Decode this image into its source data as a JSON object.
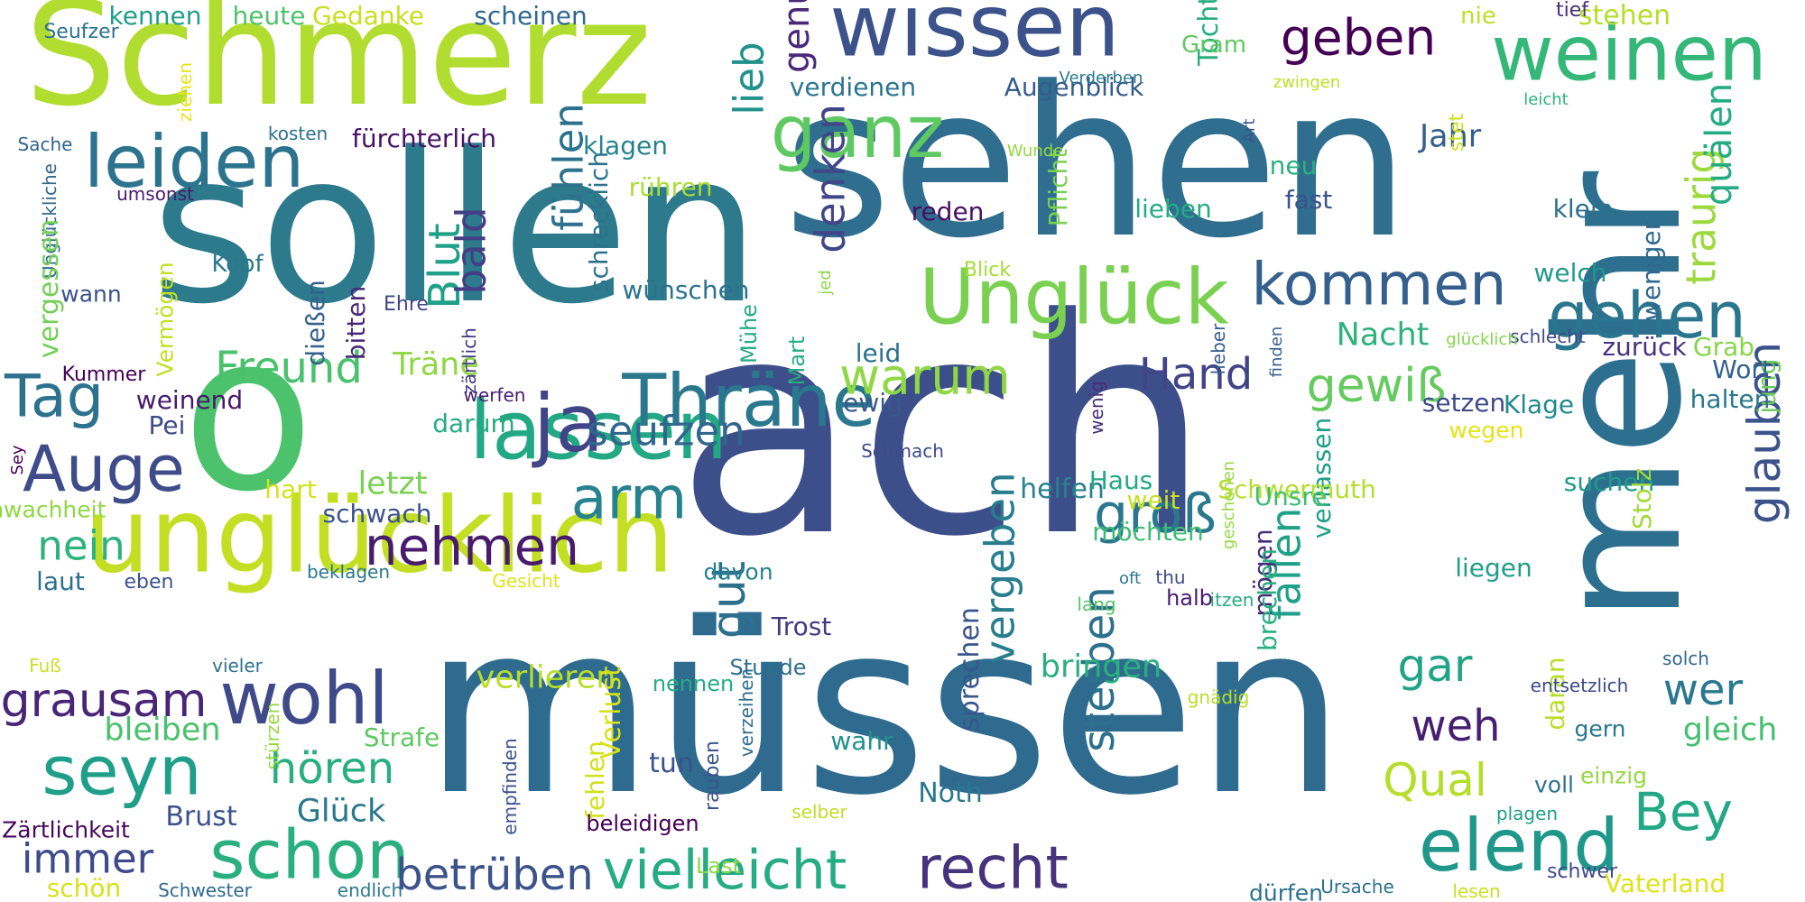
{
  "words": [
    {
      "text": "ach",
      "color": "#3d4f8a"
    },
    {
      "text": "müssen",
      "color": "#2e6b8e"
    },
    {
      "text": "sehen",
      "color": "#2f6e8e"
    },
    {
      "text": "sollen",
      "color": "#2c7a8c"
    },
    {
      "text": "mehr",
      "color": "#2d6f8e"
    },
    {
      "text": "Schmerz",
      "color": "#b0dd2f"
    },
    {
      "text": "o",
      "color": "#4cc26c"
    },
    {
      "text": "unglücklich",
      "color": "#c2df23"
    },
    {
      "text": "wissen",
      "color": "#3b528b"
    },
    {
      "text": "Unglück",
      "color": "#7ad151"
    },
    {
      "text": "weinen",
      "color": "#35b779"
    },
    {
      "text": "lassen",
      "color": "#22a884"
    },
    {
      "text": "Thräne",
      "color": "#2a788e"
    },
    {
      "text": "ganz",
      "color": "#5ec962"
    },
    {
      "text": "leiden",
      "color": "#2c738e"
    },
    {
      "text": "ja",
      "color": "#414487"
    },
    {
      "text": "kommen",
      "color": "#355f8d"
    },
    {
      "text": "gehen",
      "color": "#2a768e"
    },
    {
      "text": "elend",
      "color": "#1f988b"
    },
    {
      "text": "seyn",
      "color": "#1f9e89"
    },
    {
      "text": "schon",
      "color": "#2ab07f"
    },
    {
      "text": "wohl",
      "color": "#3e4a89"
    },
    {
      "text": "recht",
      "color": "#46337e"
    },
    {
      "text": "vielleicht",
      "color": "#25ac82"
    },
    {
      "text": "Auge",
      "color": "#3e4c8a"
    },
    {
      "text": "Tag",
      "color": "#2c728e"
    },
    {
      "text": "geben",
      "color": "#440154"
    },
    {
      "text": "warum",
      "color": "#8fd744"
    },
    {
      "text": "nehmen",
      "color": "#481b6d"
    },
    {
      "text": "arm",
      "color": "#26828e"
    },
    {
      "text": "groß",
      "color": "#2a788e"
    },
    {
      "text": "Bey",
      "color": "#22a884"
    },
    {
      "text": "traurig",
      "color": "#9bd93c"
    },
    {
      "text": "glauben",
      "color": "#3b528b"
    },
    {
      "text": "grausam",
      "color": "#482576"
    },
    {
      "text": "gewiß",
      "color": "#65cb5e"
    },
    {
      "text": "fallen",
      "color": "#1fa088"
    },
    {
      "text": "vergeben",
      "color": "#287d8e"
    },
    {
      "text": "sterben",
      "color": "#2d708e"
    },
    {
      "text": "betrüben",
      "color": "#3b528b"
    },
    {
      "text": "gar",
      "color": "#20a386"
    },
    {
      "text": "wer",
      "color": "#2a788e"
    },
    {
      "text": "Hand",
      "color": "#414487"
    },
    {
      "text": "gut",
      "color": "#2d708e"
    },
    {
      "text": "Freund",
      "color": "#4ac16d"
    },
    {
      "text": "seufzen",
      "color": "#31668e"
    },
    {
      "text": "Blut",
      "color": "#1fa088"
    },
    {
      "text": "bald",
      "color": "#433e85"
    },
    {
      "text": "fühlen",
      "color": "#2c728e"
    },
    {
      "text": "denken",
      "color": "#404688"
    },
    {
      "text": "lieb",
      "color": "#21918c"
    },
    {
      "text": "genug",
      "color": "#482878"
    },
    {
      "text": "Qual",
      "color": "#b5de2b"
    },
    {
      "text": "weh",
      "color": "#481f70"
    },
    {
      "text": "quälen",
      "color": "#25ac82"
    },
    {
      "text": "hören",
      "color": "#29af7f"
    },
    {
      "text": "nein",
      "color": "#2db27d"
    },
    {
      "text": "immer",
      "color": "#3e4a89"
    },
    {
      "text": "bringen",
      "color": "#2ab07f"
    },
    {
      "text": "verlieren",
      "color": "#b8de29"
    },
    {
      "text": "gleich",
      "color": "#44bf70"
    },
    {
      "text": "Glück",
      "color": "#2a788e"
    },
    {
      "text": "Jahr",
      "color": "#355f8d"
    },
    {
      "text": "Nacht",
      "color": "#2db27d"
    },
    {
      "text": "letzt",
      "color": "#7ad151"
    },
    {
      "text": "Träne",
      "color": "#8fd744"
    },
    {
      "text": "bleiben",
      "color": "#4ac16d"
    },
    {
      "text": "Pflicht",
      "color": "#7ad151"
    },
    {
      "text": "ewig",
      "color": "#38598c"
    },
    {
      "text": "leid",
      "color": "#2c728e"
    },
    {
      "text": "helfen",
      "color": "#26828e"
    },
    {
      "text": "sprechen",
      "color": "#39568c"
    },
    {
      "text": "schrecklich",
      "color": "#2c728e"
    },
    {
      "text": "Brust",
      "color": "#3b528b"
    },
    {
      "text": "Noth",
      "color": "#2a788e"
    },
    {
      "text": "tun",
      "color": "#3b528b"
    },
    {
      "text": "fehlen",
      "color": "#d0e11c"
    },
    {
      "text": "Verlust",
      "color": "#d8e219"
    },
    {
      "text": "wahr",
      "color": "#21918c"
    },
    {
      "text": "Haus",
      "color": "#22a884"
    },
    {
      "text": "setzen",
      "color": "#3e4a89"
    },
    {
      "text": "Klage",
      "color": "#23898e"
    },
    {
      "text": "suchen",
      "color": "#1f9a8a"
    },
    {
      "text": "Stolz",
      "color": "#a2da37"
    },
    {
      "text": "jung",
      "color": "#6ccd5a"
    },
    {
      "text": "halten",
      "color": "#2a788e"
    },
    {
      "text": "Wort",
      "color": "#33638d"
    },
    {
      "text": "Grab",
      "color": "#86d549"
    },
    {
      "text": "zurück",
      "color": "#46327e"
    },
    {
      "text": "weniger",
      "color": "#31688e"
    },
    {
      "text": "welch",
      "color": "#1f9a8a"
    },
    {
      "text": "klein",
      "color": "#2d708e"
    },
    {
      "text": "fast",
      "color": "#3b528b"
    },
    {
      "text": "neu",
      "color": "#2ab07f"
    },
    {
      "text": "lieben",
      "color": "#25ac82"
    },
    {
      "text": "reden",
      "color": "#471063"
    },
    {
      "text": "verlassen",
      "color": "#1f9e89"
    },
    {
      "text": "Tochter",
      "color": "#29af7f"
    },
    {
      "text": "Gram",
      "color": "#5ec962"
    },
    {
      "text": "Augenblick",
      "color": "#365c8d"
    },
    {
      "text": "verdienen",
      "color": "#2a768e"
    },
    {
      "text": "klagen",
      "color": "#25838e"
    },
    {
      "text": "rühren",
      "color": "#aadc32"
    },
    {
      "text": "fürchterlich",
      "color": "#471365"
    },
    {
      "text": "scheinen",
      "color": "#30698e"
    },
    {
      "text": "kennen",
      "color": "#1f9e89"
    },
    {
      "text": "heute",
      "color": "#4ec36b"
    },
    {
      "text": "Gedanke",
      "color": "#c8e020"
    },
    {
      "text": "stehen",
      "color": "#b5de2b"
    },
    {
      "text": "nie",
      "color": "#bddf26"
    },
    {
      "text": "tief",
      "color": "#472d7b"
    },
    {
      "text": "Seufzer",
      "color": "#2c728e"
    },
    {
      "text": "ziehen",
      "color": "#e5e419"
    },
    {
      "text": "Sache",
      "color": "#33638d"
    },
    {
      "text": "kosten",
      "color": "#2c728e"
    },
    {
      "text": "umsonst",
      "color": "#481b6d"
    },
    {
      "text": "Unglückliche",
      "color": "#31688e"
    },
    {
      "text": "vergessen",
      "color": "#73d056"
    },
    {
      "text": "Kopf",
      "color": "#2a788e"
    },
    {
      "text": "Vermögen",
      "color": "#c2df23"
    },
    {
      "text": "wann",
      "color": "#3b528b"
    },
    {
      "text": "Kummer",
      "color": "#440154"
    },
    {
      "text": "weinend",
      "color": "#481a6c"
    },
    {
      "text": "Pei",
      "color": "#3e4a89"
    },
    {
      "text": "Sey",
      "color": "#440154"
    },
    {
      "text": "Schwachheit",
      "color": "#8fd744"
    },
    {
      "text": "hart",
      "color": "#d2e21b"
    },
    {
      "text": "laut",
      "color": "#2d708e"
    },
    {
      "text": "eben",
      "color": "#3b528b"
    },
    {
      "text": "Fuß",
      "color": "#c8e020"
    },
    {
      "text": "vieler",
      "color": "#2c728e"
    },
    {
      "text": "Zärtlichkeit",
      "color": "#46085c"
    },
    {
      "text": "schön",
      "color": "#d8e219"
    },
    {
      "text": "Schwester",
      "color": "#30698e"
    },
    {
      "text": "endlich",
      "color": "#2a788e"
    },
    {
      "text": "stürzen",
      "color": "#95d840"
    },
    {
      "text": "Strafe",
      "color": "#5ec962"
    },
    {
      "text": "dießen",
      "color": "#355f8d"
    },
    {
      "text": "bitten",
      "color": "#482878"
    },
    {
      "text": "Ehre",
      "color": "#404588"
    },
    {
      "text": "zärtlich",
      "color": "#443983"
    },
    {
      "text": "darum",
      "color": "#25ac82"
    },
    {
      "text": "werfen",
      "color": "#481c6e"
    },
    {
      "text": "schwach",
      "color": "#3b528b"
    },
    {
      "text": "beklagen",
      "color": "#2a788e"
    },
    {
      "text": "Gesicht",
      "color": "#dfe318"
    },
    {
      "text": "davon",
      "color": "#26828e"
    },
    {
      "text": "Trost",
      "color": "#443a83"
    },
    {
      "text": "Stunde",
      "color": "#2d708e"
    },
    {
      "text": "nennen",
      "color": "#25ac82"
    },
    {
      "text": "verzeihen",
      "color": "#2f6c8e"
    },
    {
      "text": "rauben",
      "color": "#3a548c"
    },
    {
      "text": "beleidigen",
      "color": "#440154"
    },
    {
      "text": "empfinden",
      "color": "#3b528b"
    },
    {
      "text": "selber",
      "color": "#c0df25"
    },
    {
      "text": "Last",
      "color": "#8fd744"
    },
    {
      "text": "Mühe",
      "color": "#25ac82"
    },
    {
      "text": "Mart",
      "color": "#27ad81"
    },
    {
      "text": "wünschen",
      "color": "#2c728e"
    },
    {
      "text": "jed",
      "color": "#89d548"
    },
    {
      "text": "Blick",
      "color": "#a5db36"
    },
    {
      "text": "Wunde",
      "color": "#95d840"
    },
    {
      "text": "Verderben",
      "color": "#2a788e"
    },
    {
      "text": "Art",
      "color": "#3b528b"
    },
    {
      "text": "zwingen",
      "color": "#bddf26"
    },
    {
      "text": "leicht",
      "color": "#2db27d"
    },
    {
      "text": "stet",
      "color": "#cae11f"
    },
    {
      "text": "schlecht",
      "color": "#3e4989"
    },
    {
      "text": "glücklich",
      "color": "#84d44b"
    },
    {
      "text": "lieber",
      "color": "#355f8d"
    },
    {
      "text": "wenig",
      "color": "#472c7a"
    },
    {
      "text": "finden",
      "color": "#355f8d"
    },
    {
      "text": "geschehen",
      "color": "#95d840"
    },
    {
      "text": "Schwermuth",
      "color": "#b5de2b"
    },
    {
      "text": "wegen",
      "color": "#e5e419"
    },
    {
      "text": "Unsre",
      "color": "#3fbc73"
    },
    {
      "text": "weit",
      "color": "#cae11f"
    },
    {
      "text": "möchten",
      "color": "#3fbc73"
    },
    {
      "text": "thu",
      "color": "#3e4a89"
    },
    {
      "text": "oft",
      "color": "#2a788e"
    },
    {
      "text": "lang",
      "color": "#56c667"
    },
    {
      "text": "halb",
      "color": "#481b6d"
    },
    {
      "text": "itzen",
      "color": "#27ad81"
    },
    {
      "text": "mögen",
      "color": "#472d7b"
    },
    {
      "text": "brechen",
      "color": "#2ab07f"
    },
    {
      "text": "liegen",
      "color": "#1f9e89"
    },
    {
      "text": "solch",
      "color": "#31688e"
    },
    {
      "text": "daran",
      "color": "#b8de29"
    },
    {
      "text": "entsetzlich",
      "color": "#3e4a89"
    },
    {
      "text": "gern",
      "color": "#2a788e"
    },
    {
      "text": "gnädig",
      "color": "#b8de29"
    },
    {
      "text": "voll",
      "color": "#2c728e"
    },
    {
      "text": "einzig",
      "color": "#95d840"
    },
    {
      "text": "plagen",
      "color": "#1f9e89"
    },
    {
      "text": "schwer",
      "color": "#3e4a89"
    },
    {
      "text": "Vaterland",
      "color": "#dde318"
    },
    {
      "text": "dürfen",
      "color": "#2c728e"
    },
    {
      "text": "Ursache",
      "color": "#2d708e"
    },
    {
      "text": "lesen",
      "color": "#c8e020"
    },
    {
      "text": "Schmach",
      "color": "#3e4a89"
    }
  ]
}
